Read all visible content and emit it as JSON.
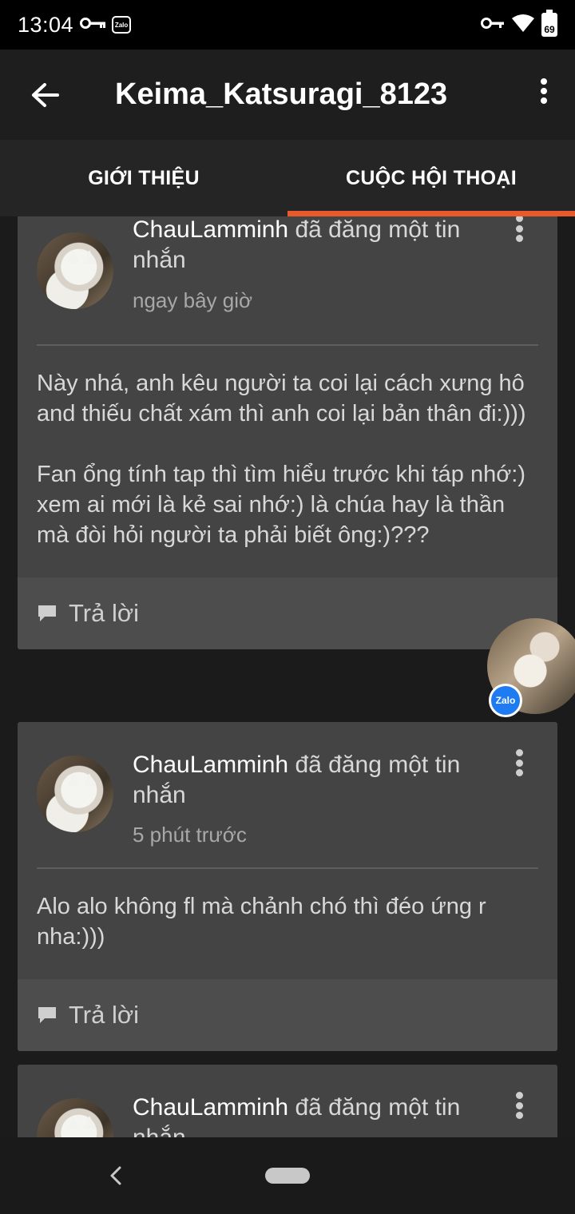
{
  "status_bar": {
    "time": "13:04",
    "battery_level": "69",
    "icons": [
      "vpn-key-icon",
      "zalo-icon",
      "key-icon",
      "wifi-icon",
      "battery-icon"
    ],
    "zalo_label": "Zalo"
  },
  "app_bar": {
    "title": "Keima_Katsuragi_8123",
    "back_icon": "arrow-left-icon",
    "menu_icon": "more-vertical-icon"
  },
  "tabs": [
    {
      "label": "GIỚI THIỆU",
      "active": false
    },
    {
      "label": "CUỘC HỘI THOẠI",
      "active": true
    }
  ],
  "accent_color": "#e8592c",
  "posts": [
    {
      "author": "ChauLamminh",
      "action": " đã đăng một tin nhắn",
      "time": "ngay bây giờ",
      "paragraphs": [
        "Này nhá, anh kêu người ta coi lại cách xưng hô and thiếu chất xám thì anh coi lại bản thân đi:)))",
        "Fan ổng tính tap thì tìm hiểu trước khi táp nhớ:) xem ai mới là kẻ sai nhớ:) là chúa hay là thần mà đòi hỏi người ta phải biết ông:)???"
      ],
      "reply_label": "Trả lời"
    },
    {
      "author": "ChauLamminh",
      "action": " đã đăng một tin nhắn",
      "time": "5 phút trước",
      "paragraphs": [
        "Alo alo không fl mà chảnh chó thì đéo ứng r nha:)))"
      ],
      "reply_label": "Trả lời"
    },
    {
      "author": "ChauLamminh",
      "action": " đã đăng một tin nhắn"
    }
  ],
  "floating_bubble": {
    "badge_label": "Zalo"
  }
}
